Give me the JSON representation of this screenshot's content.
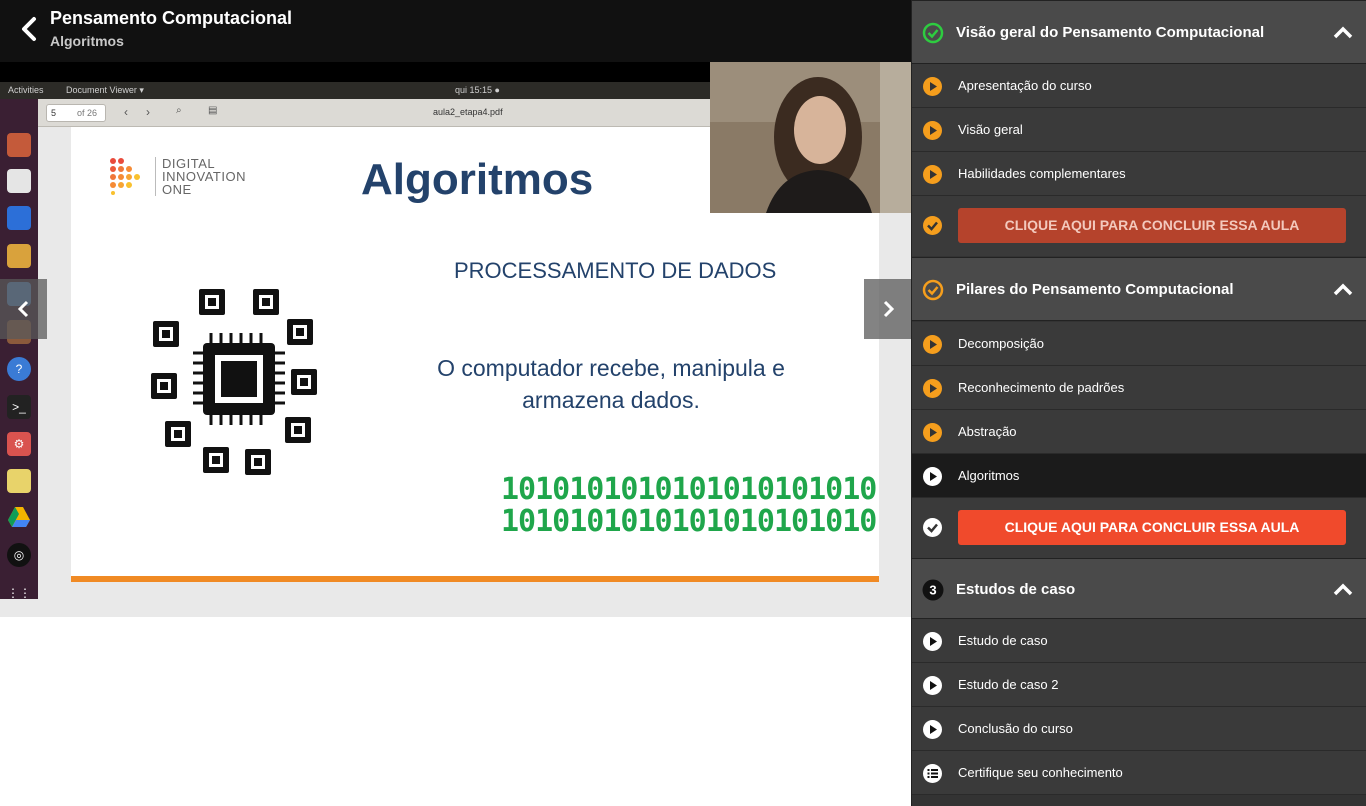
{
  "header": {
    "course_title": "Pensamento Computacional",
    "lesson_title": "Algoritmos"
  },
  "video": {
    "os": {
      "activities": "Activities",
      "app_menu": "Document Viewer ▾",
      "clock": "qui 15:15 ●"
    },
    "viewer": {
      "page_current": "5",
      "page_total": "of 26",
      "filename": "aula2_etapa4.pdf"
    },
    "slide": {
      "logo_text": [
        "DIGITAL",
        "INNOVATION",
        "ONE"
      ],
      "title": "Algoritmos",
      "subtitle": "PROCESSAMENTO DE DADOS",
      "text_line1": "O computador recebe, manipula e",
      "text_line2": "armazena dados.",
      "binary_line1": "1010101010101010101010",
      "binary_line2": "1010101010101010101010",
      "accent_color": "#f08a24",
      "title_color": "#23426b",
      "binary_color": "#1fa64b"
    }
  },
  "sidebar": {
    "sections": [
      {
        "number": "",
        "title": "Visão geral do Pensamento Computacional",
        "status": "completed",
        "items": [
          {
            "label": "Apresentação do curso",
            "state": "watched"
          },
          {
            "label": "Visão geral",
            "state": "watched"
          },
          {
            "label": "Habilidades complementares",
            "state": "watched"
          }
        ],
        "complete_button": "CLIQUE AQUI PARA CONCLUIR ESSA AULA"
      },
      {
        "number": "",
        "title": "Pilares do Pensamento Computacional",
        "status": "in-progress",
        "items": [
          {
            "label": "Decomposição",
            "state": "watched"
          },
          {
            "label": "Reconhecimento de padrões",
            "state": "watched"
          },
          {
            "label": "Abstração",
            "state": "watched"
          },
          {
            "label": "Algoritmos",
            "state": "current"
          }
        ],
        "complete_button": "CLIQUE AQUI PARA CONCLUIR ESSA AULA"
      },
      {
        "number": "3",
        "title": "Estudos de caso",
        "status": "pending",
        "items": [
          {
            "label": "Estudo de caso",
            "state": "pending"
          },
          {
            "label": "Estudo de caso 2",
            "state": "pending"
          },
          {
            "label": "Conclusão do curso",
            "state": "pending"
          },
          {
            "label": "Certifique seu conhecimento",
            "state": "quiz"
          }
        ]
      }
    ]
  },
  "colors": {
    "progress_orange": "#f59e1d",
    "complete_green": "#2ecc40",
    "cta_red": "#f04a2c",
    "cta_red_done": "#b5432c"
  }
}
